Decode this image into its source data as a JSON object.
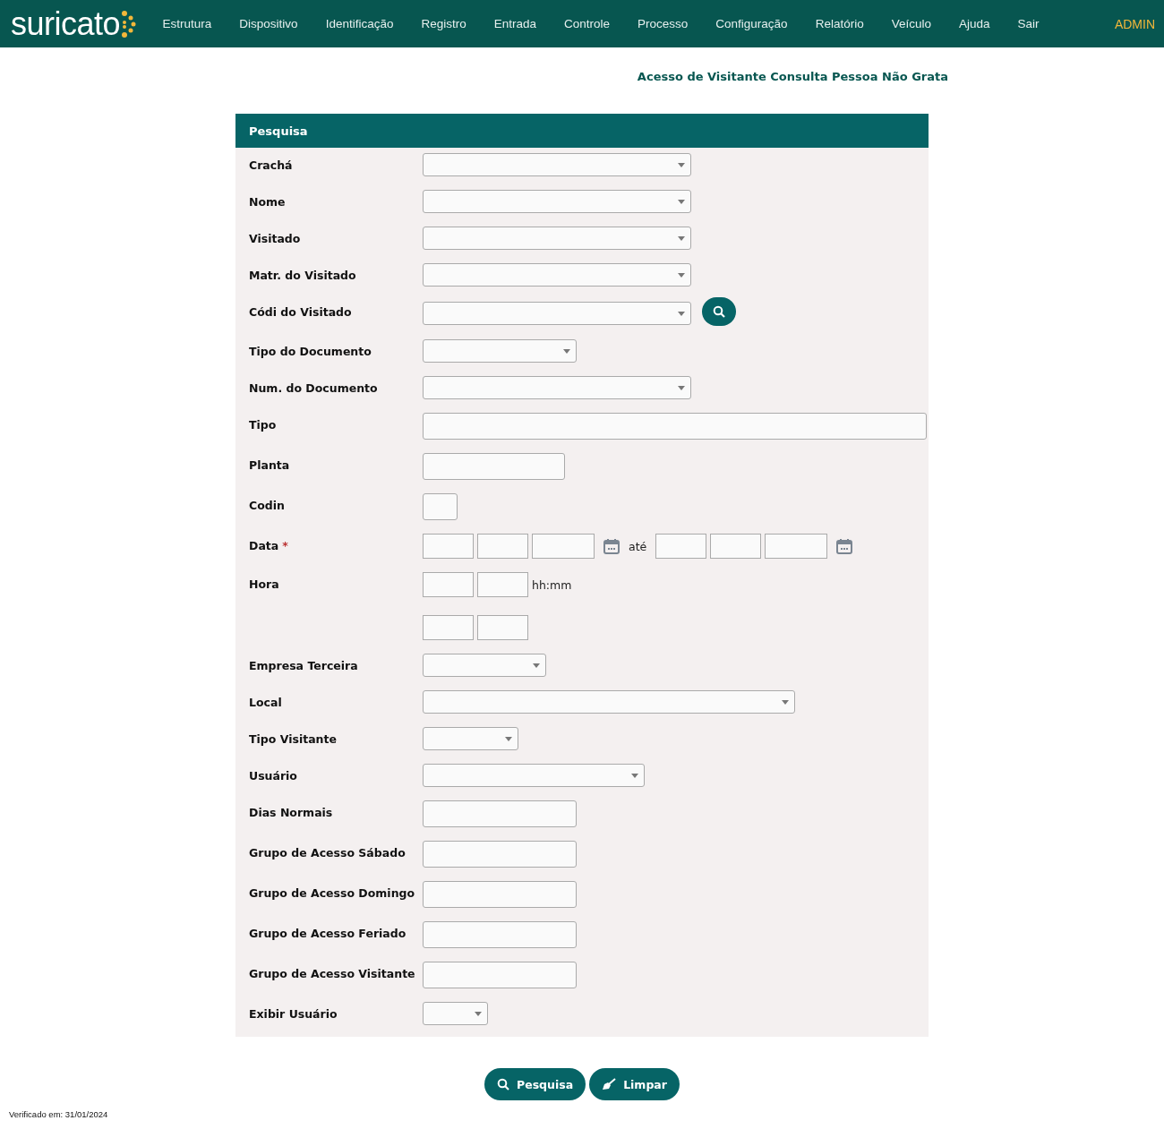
{
  "nav": {
    "logo": "suricato",
    "items": [
      "Estrutura",
      "Dispositivo",
      "Identificação",
      "Registro",
      "Entrada",
      "Controle",
      "Processo",
      "Configuração",
      "Relatório",
      "Veículo",
      "Ajuda",
      "Sair"
    ],
    "user": "ADMIN"
  },
  "page_title": "Acesso de Visitante Consulta Pessoa Não Grata",
  "panel": {
    "title": "Pesquisa",
    "fields": [
      {
        "label": "Crachá",
        "kind": "select"
      },
      {
        "label": "Nome",
        "kind": "select"
      },
      {
        "label": "Visitado",
        "kind": "select"
      },
      {
        "label": "Matr. do Visitado",
        "kind": "select"
      },
      {
        "label": "Códi do Visitado",
        "kind": "select-search"
      },
      {
        "label": "Tipo do Documento",
        "kind": "select"
      },
      {
        "label": "Num. do Documento",
        "kind": "select"
      },
      {
        "label": "Tipo",
        "kind": "text"
      },
      {
        "label": "Planta",
        "kind": "text"
      },
      {
        "label": "Codin",
        "kind": "text"
      },
      {
        "label": "Data",
        "kind": "date-range",
        "required_mark": "*",
        "separator": "até"
      },
      {
        "label": "Hora",
        "kind": "time-range",
        "hint": "hh:mm"
      },
      {
        "label": "Empresa Terceira",
        "kind": "select"
      },
      {
        "label": "Local",
        "kind": "select"
      },
      {
        "label": "Tipo Visitante",
        "kind": "select"
      },
      {
        "label": "Usuário",
        "kind": "select"
      },
      {
        "label": "Dias Normais",
        "kind": "text"
      },
      {
        "label": "Grupo de Acesso Sábado",
        "kind": "text"
      },
      {
        "label": "Grupo de Acesso Domingo",
        "kind": "text"
      },
      {
        "label": "Grupo de Acesso Feriado",
        "kind": "text"
      },
      {
        "label": "Grupo de Acesso Visitante",
        "kind": "text"
      },
      {
        "label": "Exibir Usuário",
        "kind": "select"
      }
    ]
  },
  "buttons": [
    {
      "label": "Pesquisa",
      "kind": "search"
    },
    {
      "label": "Limpar",
      "kind": "clear"
    }
  ],
  "footer": "Verificado em: 31/01/2024"
}
